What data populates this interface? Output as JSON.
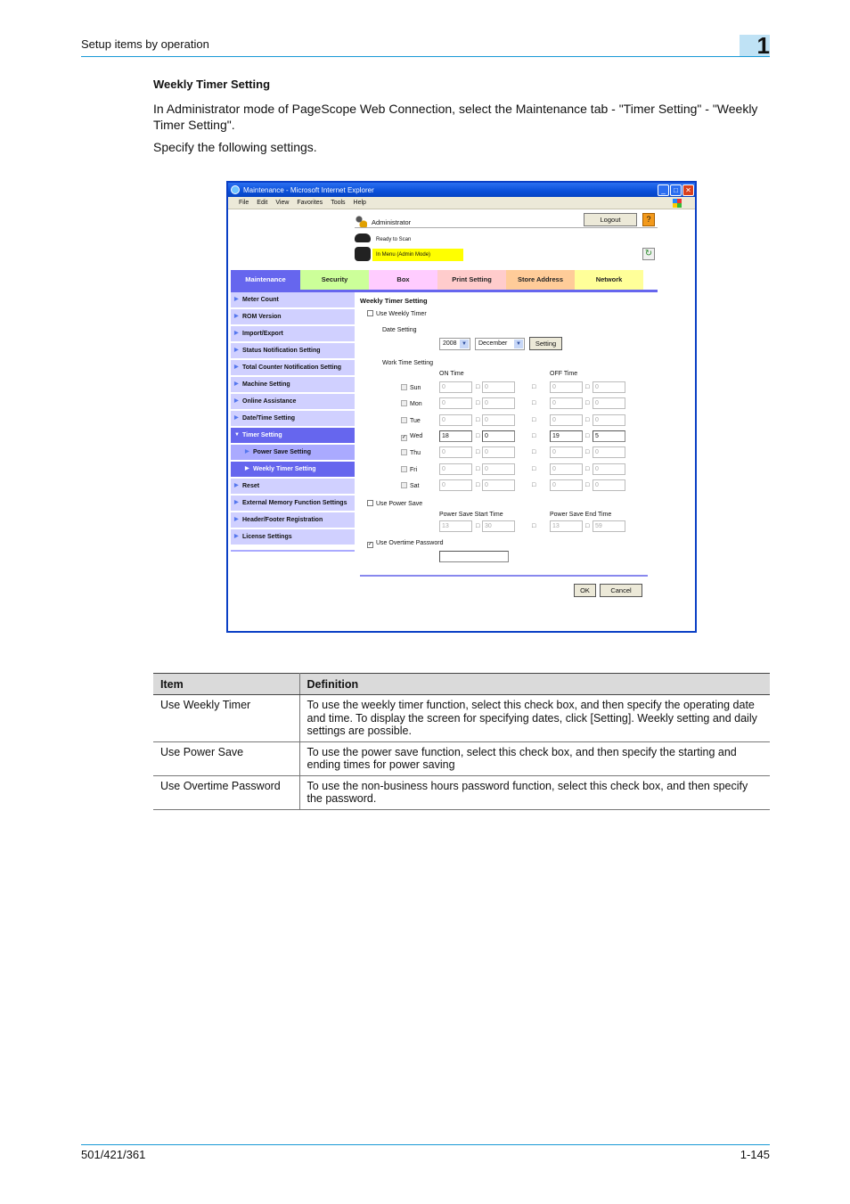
{
  "page_header": {
    "section": "Setup items by operation",
    "chapter": "1"
  },
  "doc": {
    "title": "Weekly Timer Setting",
    "intro": "In Administrator mode of PageScope Web Connection, select the Maintenance tab - \"Timer Setting\" - \"Weekly Timer Setting\".",
    "instruction": "Specify the following settings."
  },
  "window": {
    "title": "Maintenance - Microsoft Internet Explorer",
    "menu": [
      "File",
      "Edit",
      "View",
      "Favorites",
      "Tools",
      "Help"
    ],
    "user": "Administrator",
    "logout_label": "Logout",
    "help_label": "?",
    "status_ready": "Ready to Scan",
    "status_mode": "In Menu (Admin Mode)",
    "refresh_label": "↻",
    "tabs": [
      {
        "label": "Maintenance",
        "bg": "#6666ee",
        "color": "#ffffff"
      },
      {
        "label": "Security",
        "bg": "#ccff99",
        "color": "#222222"
      },
      {
        "label": "Box",
        "bg": "#ffccff",
        "color": "#222222"
      },
      {
        "label": "Print Setting",
        "bg": "#ffcccc",
        "color": "#222222"
      },
      {
        "label": "Store Address",
        "bg": "#ffcc99",
        "color": "#222222"
      },
      {
        "label": "Network",
        "bg": "#ffff99",
        "color": "#222222"
      }
    ],
    "sidebar": [
      {
        "label": "Meter Count"
      },
      {
        "label": "ROM Version"
      },
      {
        "label": "Import/Export"
      },
      {
        "label": "Status Notification Setting"
      },
      {
        "label": "Total Counter Notification Setting"
      },
      {
        "label": "Machine Setting"
      },
      {
        "label": "Online Assistance"
      },
      {
        "label": "Date/Time Setting"
      },
      {
        "label": "Timer Setting"
      },
      {
        "label": "Power Save Setting"
      },
      {
        "label": "Weekly Timer Setting"
      },
      {
        "label": "Reset"
      },
      {
        "label": "External Memory Function Settings"
      },
      {
        "label": "Header/Footer Registration"
      },
      {
        "label": "License Settings"
      }
    ],
    "form": {
      "heading": "Weekly Timer Setting",
      "use_weekly_timer": {
        "label": "Use Weekly Timer",
        "checked": false
      },
      "date_setting_label": "Date Setting",
      "year": "2008",
      "month": "December",
      "setting_button": "Setting",
      "work_time_label": "Work Time Setting",
      "on_time_label": "ON Time",
      "off_time_label": "OFF Time",
      "days": [
        {
          "day": "Sun",
          "checked": false,
          "on_h": "0",
          "on_m": "0",
          "off_h": "0",
          "off_m": "0"
        },
        {
          "day": "Mon",
          "checked": false,
          "on_h": "0",
          "on_m": "0",
          "off_h": "0",
          "off_m": "0"
        },
        {
          "day": "Tue",
          "checked": false,
          "on_h": "0",
          "on_m": "0",
          "off_h": "0",
          "off_m": "0"
        },
        {
          "day": "Wed",
          "checked": true,
          "on_h": "18",
          "on_m": "0",
          "off_h": "19",
          "off_m": "5"
        },
        {
          "day": "Thu",
          "checked": false,
          "on_h": "0",
          "on_m": "0",
          "off_h": "0",
          "off_m": "0"
        },
        {
          "day": "Fri",
          "checked": false,
          "on_h": "0",
          "on_m": "0",
          "off_h": "0",
          "off_m": "0"
        },
        {
          "day": "Sat",
          "checked": false,
          "on_h": "0",
          "on_m": "0",
          "off_h": "0",
          "off_m": "0"
        }
      ],
      "separator": "□",
      "use_power_save": {
        "label": "Use Power Save",
        "checked": false
      },
      "ps_start_label": "Power Save Start Time",
      "ps_end_label": "Power Save End Time",
      "ps_start_h": "13",
      "ps_start_m": "30",
      "ps_end_h": "13",
      "ps_end_m": "59",
      "use_overtime_password": {
        "label": "Use Overtime Password",
        "checked": true
      },
      "password_value": "",
      "ok_label": "OK",
      "cancel_label": "Cancel"
    }
  },
  "table": {
    "headers": [
      "Item",
      "Definition"
    ],
    "rows": [
      [
        "Use Weekly Timer",
        "To use the weekly timer function, select this check box, and then specify the operating date and time. To display the screen for specifying dates, click [Setting]. Weekly setting and daily settings are possible."
      ],
      [
        "Use Power Save",
        "To use the power save function, select this check box, and then specify the starting and ending times for power saving"
      ],
      [
        "Use Overtime Password",
        "To use the non-business hours password function, select this check box, and then specify the password."
      ]
    ]
  },
  "footer": {
    "model": "501/421/361",
    "page": "1-145"
  }
}
